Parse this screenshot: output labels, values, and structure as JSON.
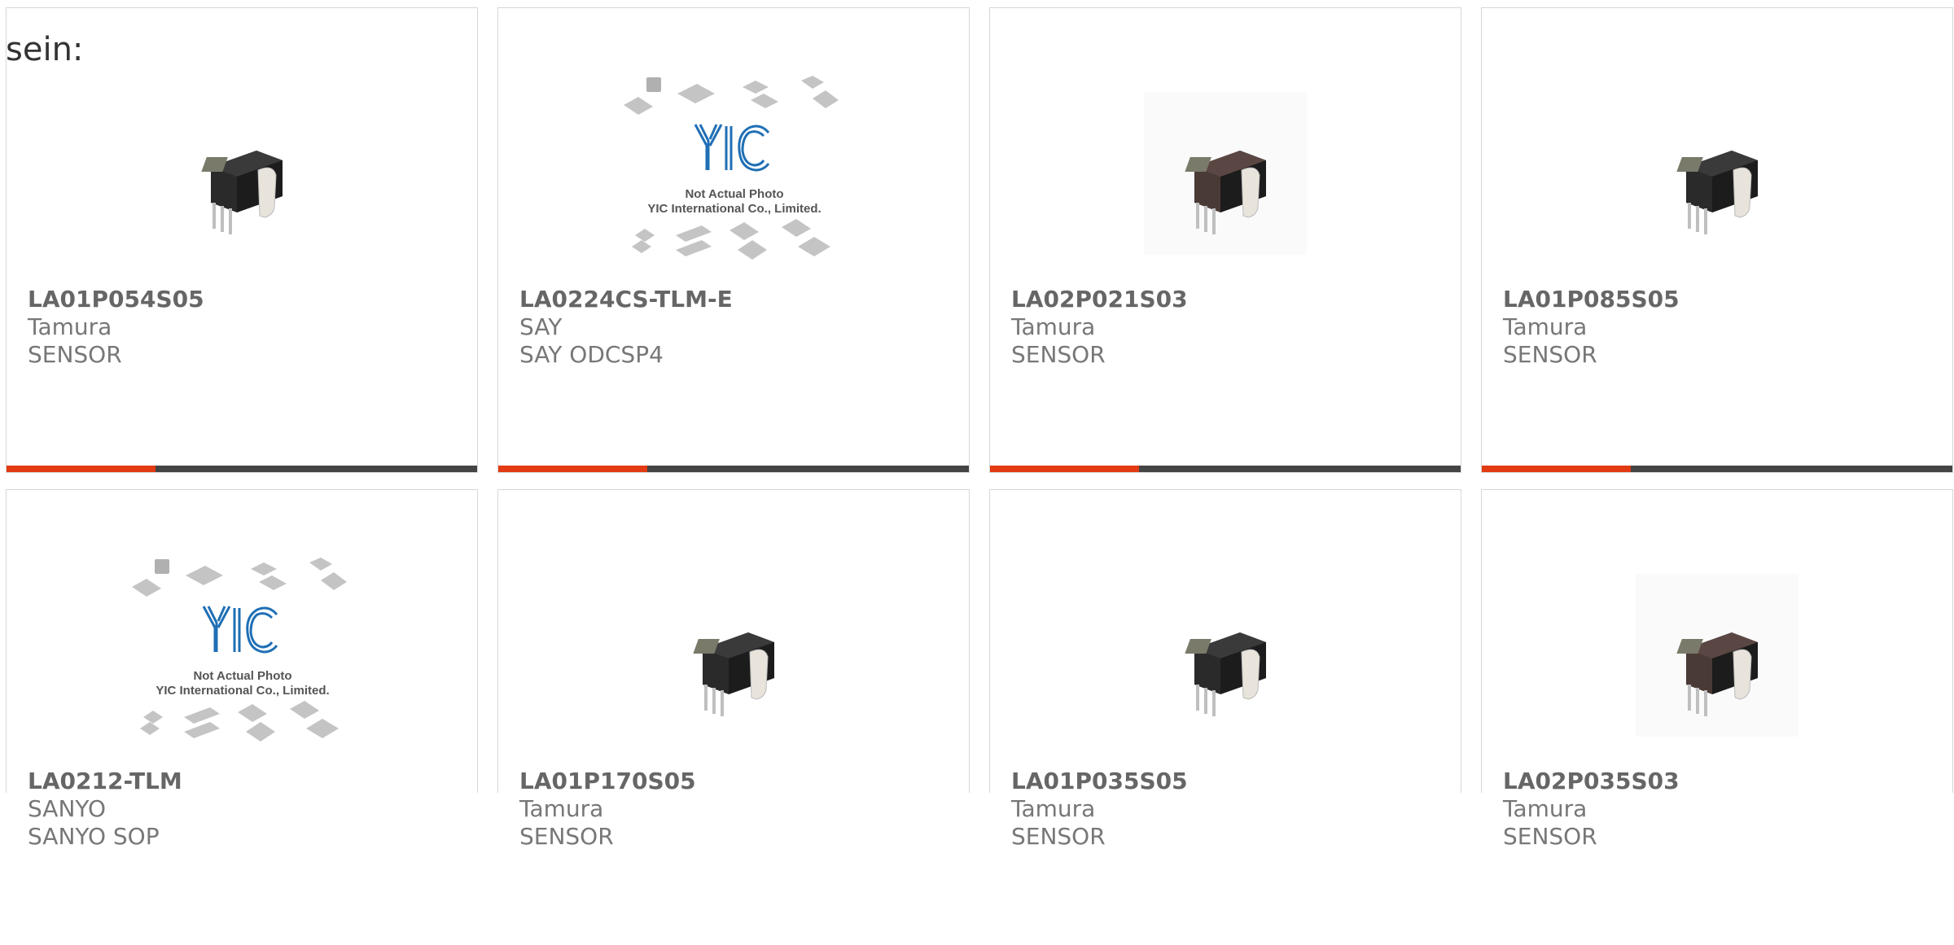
{
  "intro_text": "sein:",
  "colors": {
    "accent": "#e23a12",
    "bar": "#444444",
    "text": "#666666",
    "yic_blue": "#1f6fb5"
  },
  "placeholder": {
    "line1": "Not Actual Photo",
    "line2": "YIC International Co., Limited.",
    "logo": "YIC"
  },
  "products": [
    {
      "part_no": "LA01P054S05",
      "maker": "Tamura",
      "package": "SENSOR",
      "image": "sensor-black"
    },
    {
      "part_no": "LA0224CS-TLM-E",
      "maker": "SAY",
      "package": "SAY ODCSP4",
      "image": "yic-placeholder"
    },
    {
      "part_no": "LA02P021S03",
      "maker": "Tamura",
      "package": "SENSOR",
      "image": "sensor-brown"
    },
    {
      "part_no": "LA01P085S05",
      "maker": "Tamura",
      "package": "SENSOR",
      "image": "sensor-black"
    },
    {
      "part_no": "LA0212-TLM",
      "maker": "SANYO",
      "package": "SANYO SOP",
      "image": "yic-placeholder"
    },
    {
      "part_no": "LA01P170S05",
      "maker": "Tamura",
      "package": "SENSOR",
      "image": "sensor-black"
    },
    {
      "part_no": "LA01P035S05",
      "maker": "Tamura",
      "package": "SENSOR",
      "image": "sensor-black"
    },
    {
      "part_no": "LA02P035S03",
      "maker": "Tamura",
      "package": "SENSOR",
      "image": "sensor-brown"
    }
  ]
}
